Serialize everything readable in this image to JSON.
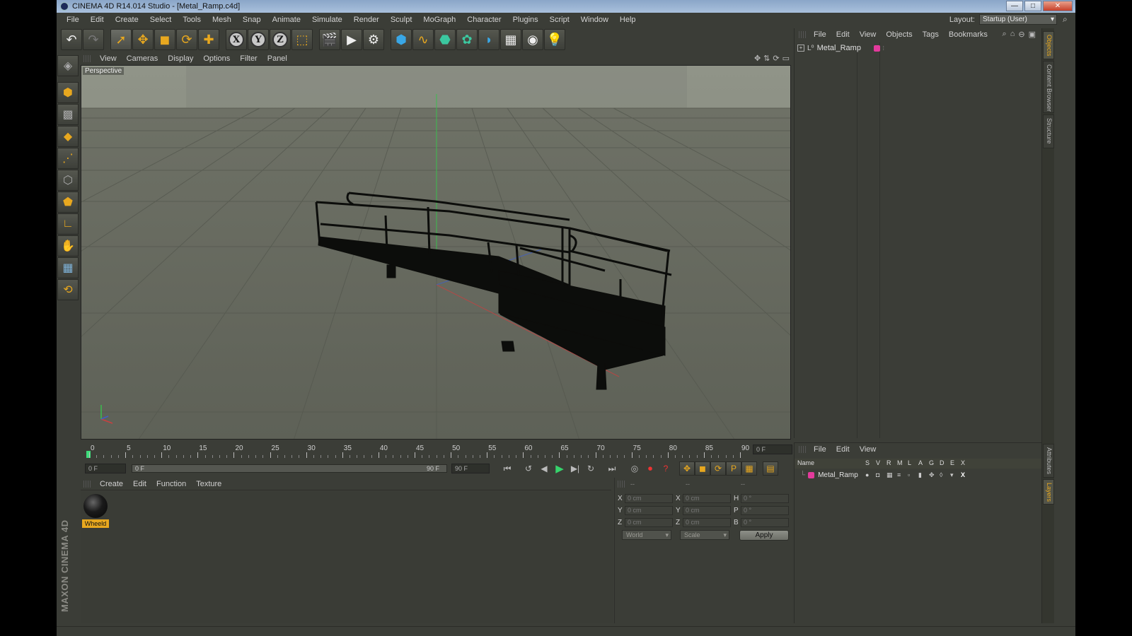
{
  "window": {
    "title": "CINEMA 4D R14.014 Studio - [Metal_Ramp.c4d]",
    "min_label": "—",
    "max_label": "□",
    "close_label": "✕"
  },
  "menubar": {
    "items": [
      "File",
      "Edit",
      "Create",
      "Select",
      "Tools",
      "Mesh",
      "Snap",
      "Animate",
      "Simulate",
      "Render",
      "Sculpt",
      "MoGraph",
      "Character",
      "Plugins",
      "Script",
      "Window",
      "Help"
    ]
  },
  "layout": {
    "label": "Layout:",
    "value": "Startup (User)"
  },
  "viewport": {
    "menu": [
      "View",
      "Cameras",
      "Display",
      "Options",
      "Filter",
      "Panel"
    ],
    "label": "Perspective"
  },
  "timeline": {
    "ticks": [
      "0",
      "5",
      "10",
      "15",
      "20",
      "25",
      "30",
      "35",
      "40",
      "45",
      "50",
      "55",
      "60",
      "65",
      "70",
      "75",
      "80",
      "85",
      "90"
    ],
    "current_frame": "0 F",
    "start_field": "0 F",
    "range_start": "0 F",
    "range_end": "90 F",
    "end_field": "90 F"
  },
  "material_manager": {
    "menu": [
      "Create",
      "Edit",
      "Function",
      "Texture"
    ],
    "materials": [
      {
        "name": "Wheeld"
      }
    ]
  },
  "coordinates": {
    "headers": [
      "--",
      "--",
      "--"
    ],
    "rows": [
      {
        "a1": "X",
        "v1": "0 cm",
        "a2": "X",
        "v2": "0 cm",
        "a3": "H",
        "v3": "0 °"
      },
      {
        "a1": "Y",
        "v1": "0 cm",
        "a2": "Y",
        "v2": "0 cm",
        "a3": "P",
        "v3": "0 °"
      },
      {
        "a1": "Z",
        "v1": "0 cm",
        "a2": "Z",
        "v2": "0 cm",
        "a3": "B",
        "v3": "0 °"
      }
    ],
    "mode_world": "World",
    "mode_scale": "Scale",
    "apply": "Apply"
  },
  "object_manager": {
    "menu": [
      "File",
      "Edit",
      "View",
      "Objects",
      "Tags",
      "Bookmarks"
    ],
    "objects": [
      {
        "name": "Metal_Ramp",
        "color": "#e33a9c"
      }
    ]
  },
  "layer_manager": {
    "menu": [
      "File",
      "Edit",
      "View"
    ],
    "columns": [
      "Name",
      "S",
      "V",
      "R",
      "M",
      "L",
      "A",
      "G",
      "D",
      "E",
      "X"
    ],
    "layers": [
      {
        "name": "Metal_Ramp",
        "color": "#e33a9c"
      }
    ]
  },
  "side_tabs": {
    "top": [
      "Objects",
      "Content Browser",
      "Structure"
    ],
    "bottom": [
      "Attributes",
      "Layers"
    ]
  },
  "branding": {
    "logo": "MAXON CINEMA 4D"
  },
  "colors": {
    "accent": "#e8a81f",
    "layer": "#e33a9c",
    "play": "#36d46c",
    "viewport_bg": "#6f7268"
  }
}
